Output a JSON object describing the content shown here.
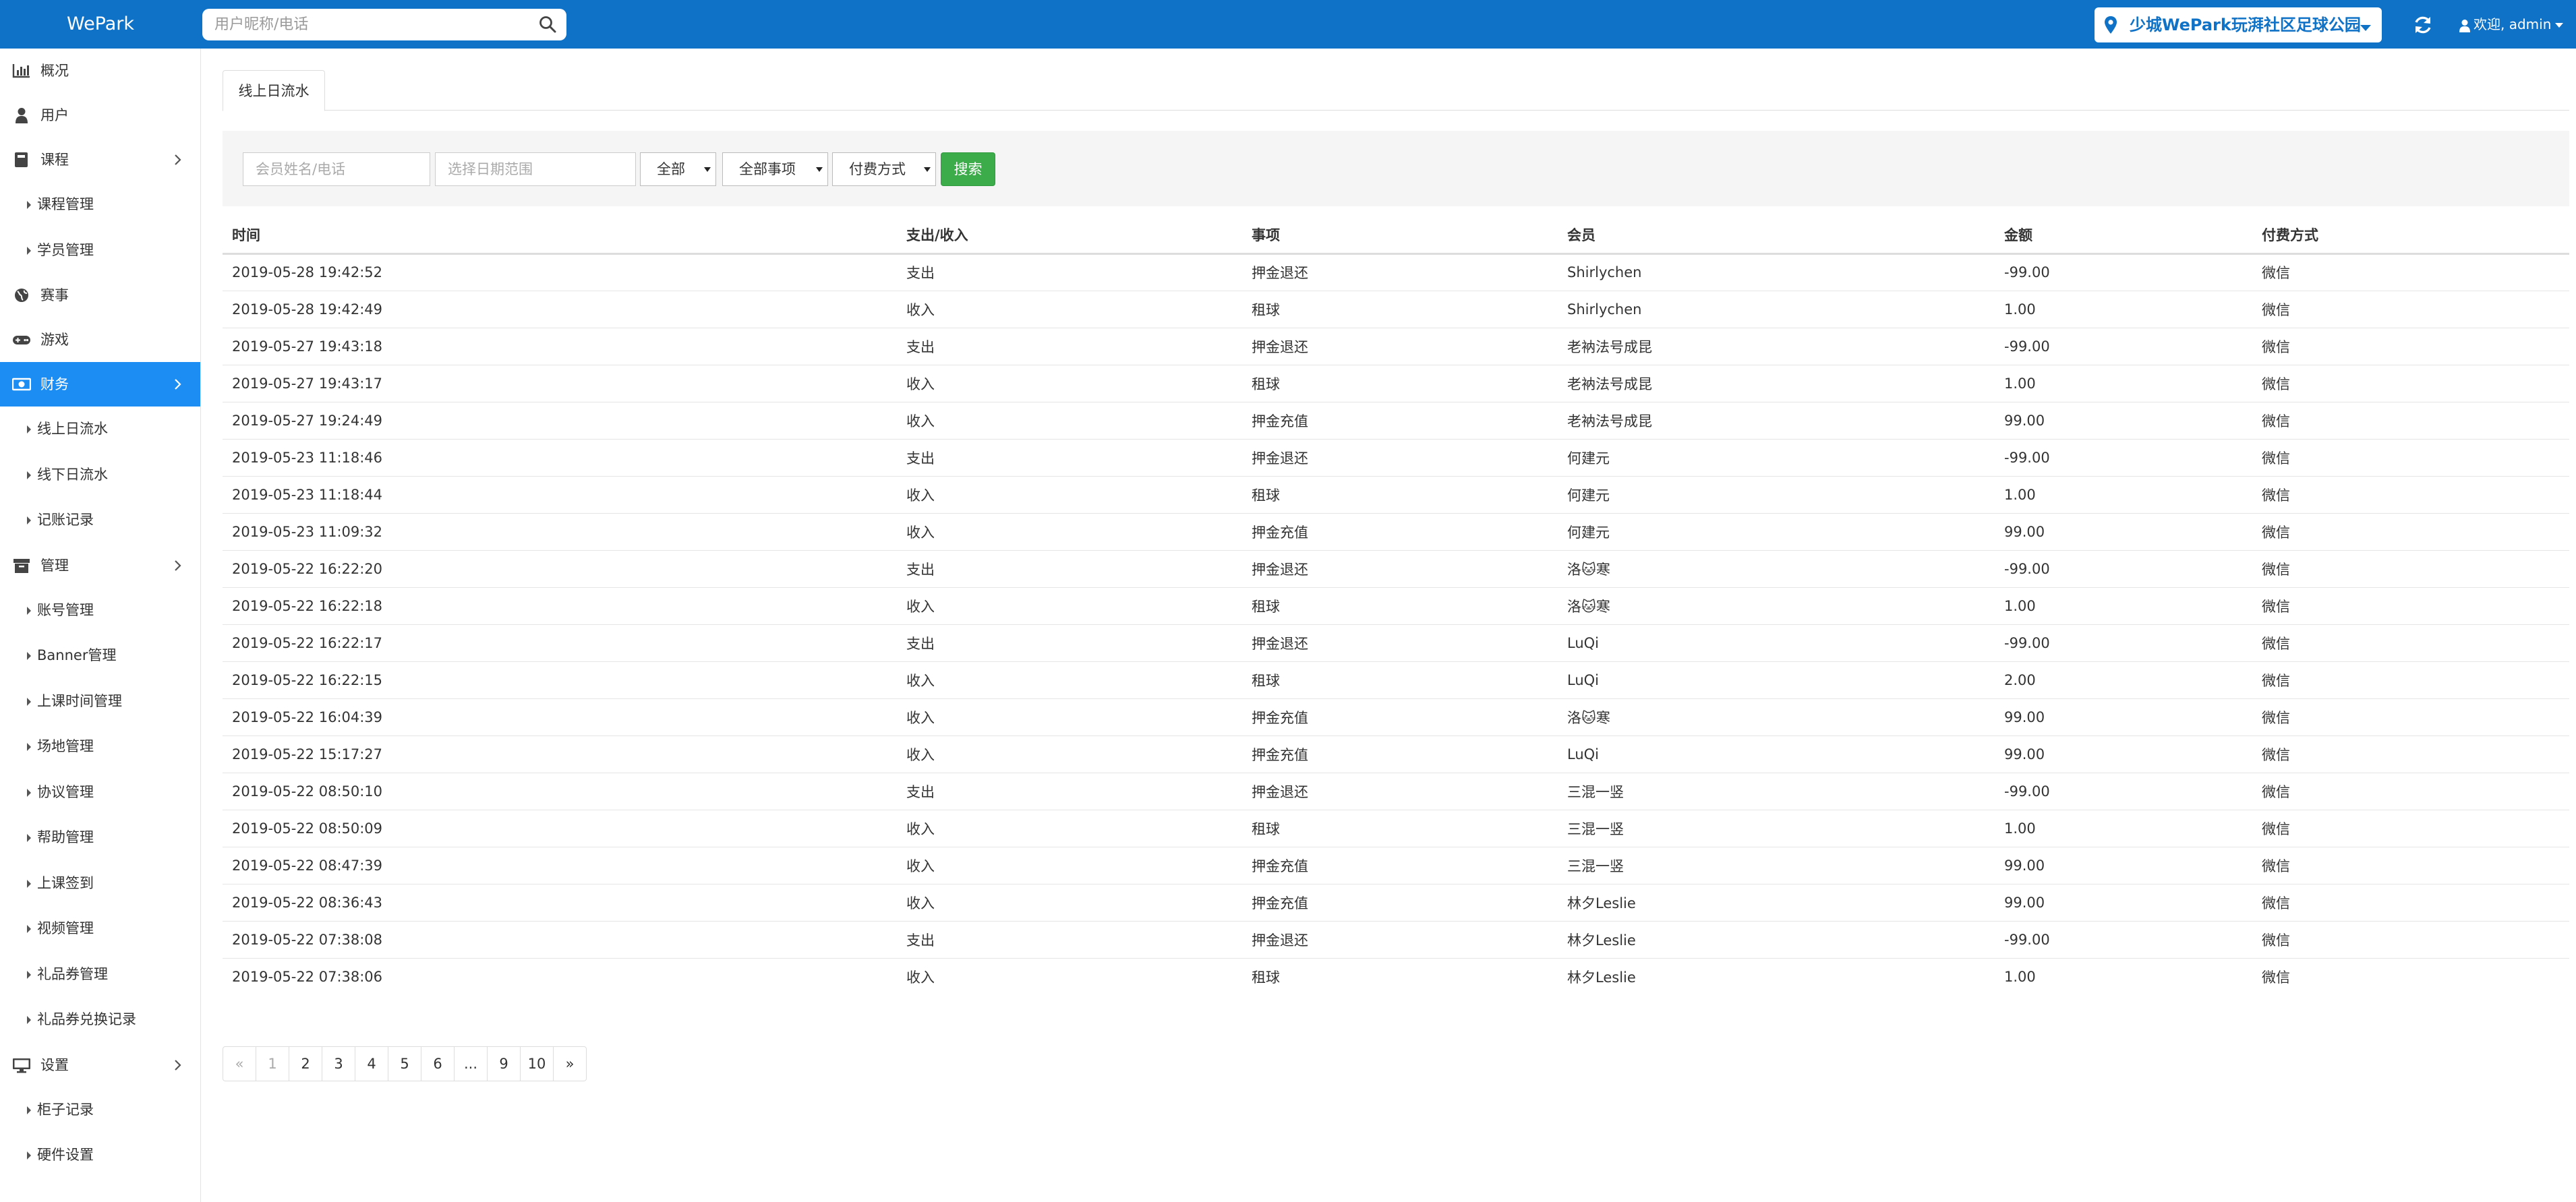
{
  "brand": "WePark",
  "search": {
    "placeholder": "用户昵称/电话"
  },
  "location": {
    "name": "少城WePark玩湃社区足球公园"
  },
  "user": {
    "greeting": "欢迎, admin"
  },
  "colors": {
    "topbar": "#1072c6",
    "active_nav": "#1c8ef3",
    "search_button": "#3cab4a"
  },
  "sidebar": {
    "items": [
      {
        "label": "概况",
        "icon": "bar-chart-icon"
      },
      {
        "label": "用户",
        "icon": "user-icon"
      },
      {
        "label": "课程",
        "icon": "book-icon",
        "expandable": true
      },
      {
        "label": "课程管理",
        "sub": true
      },
      {
        "label": "学员管理",
        "sub": true
      },
      {
        "label": "赛事",
        "icon": "globe-icon"
      },
      {
        "label": "游戏",
        "icon": "gamepad-icon"
      },
      {
        "label": "财务",
        "icon": "money-icon",
        "expandable": true,
        "active": true
      },
      {
        "label": "线上日流水",
        "sub": true
      },
      {
        "label": "线下日流水",
        "sub": true
      },
      {
        "label": "记账记录",
        "sub": true
      },
      {
        "label": "管理",
        "icon": "archive-icon",
        "expandable": true
      },
      {
        "label": "账号管理",
        "sub": true
      },
      {
        "label": "Banner管理",
        "sub": true
      },
      {
        "label": "上课时间管理",
        "sub": true
      },
      {
        "label": "场地管理",
        "sub": true
      },
      {
        "label": "协议管理",
        "sub": true
      },
      {
        "label": "帮助管理",
        "sub": true
      },
      {
        "label": "上课签到",
        "sub": true
      },
      {
        "label": "视频管理",
        "sub": true
      },
      {
        "label": "礼品券管理",
        "sub": true
      },
      {
        "label": "礼品券兑换记录",
        "sub": true
      },
      {
        "label": "设置",
        "icon": "desktop-icon",
        "expandable": true
      },
      {
        "label": "柜子记录",
        "sub": true
      },
      {
        "label": "硬件设置",
        "sub": true
      }
    ]
  },
  "tab": {
    "label": "线上日流水"
  },
  "filters": {
    "member_placeholder": "会员姓名/电话",
    "date_placeholder": "选择日期范围",
    "type_value": "全部",
    "item_value": "全部事项",
    "payment_value": "付费方式",
    "search_label": "搜索"
  },
  "table": {
    "headers": [
      "时间",
      "支出/收入",
      "事项",
      "会员",
      "金额",
      "付费方式"
    ],
    "rows": [
      [
        "2019-05-28 19:42:52",
        "支出",
        "押金退还",
        "Shirlychen",
        "-99.00",
        "微信"
      ],
      [
        "2019-05-28 19:42:49",
        "收入",
        "租球",
        "Shirlychen",
        "1.00",
        "微信"
      ],
      [
        "2019-05-27 19:43:18",
        "支出",
        "押金退还",
        "老衲法号成昆",
        "-99.00",
        "微信"
      ],
      [
        "2019-05-27 19:43:17",
        "收入",
        "租球",
        "老衲法号成昆",
        "1.00",
        "微信"
      ],
      [
        "2019-05-27 19:24:49",
        "收入",
        "押金充值",
        "老衲法号成昆",
        "99.00",
        "微信"
      ],
      [
        "2019-05-23 11:18:46",
        "支出",
        "押金退还",
        "何建元",
        "-99.00",
        "微信"
      ],
      [
        "2019-05-23 11:18:44",
        "收入",
        "租球",
        "何建元",
        "1.00",
        "微信"
      ],
      [
        "2019-05-23 11:09:32",
        "收入",
        "押金充值",
        "何建元",
        "99.00",
        "微信"
      ],
      [
        "2019-05-22 16:22:20",
        "支出",
        "押金退还",
        "洛🐱寒",
        "-99.00",
        "微信"
      ],
      [
        "2019-05-22 16:22:18",
        "收入",
        "租球",
        "洛🐱寒",
        "1.00",
        "微信"
      ],
      [
        "2019-05-22 16:22:17",
        "支出",
        "押金退还",
        "LuQi",
        "-99.00",
        "微信"
      ],
      [
        "2019-05-22 16:22:15",
        "收入",
        "租球",
        "LuQi",
        "2.00",
        "微信"
      ],
      [
        "2019-05-22 16:04:39",
        "收入",
        "押金充值",
        "洛🐱寒",
        "99.00",
        "微信"
      ],
      [
        "2019-05-22 15:17:27",
        "收入",
        "押金充值",
        "LuQi",
        "99.00",
        "微信"
      ],
      [
        "2019-05-22 08:50:10",
        "支出",
        "押金退还",
        "三混一竖",
        "-99.00",
        "微信"
      ],
      [
        "2019-05-22 08:50:09",
        "收入",
        "租球",
        "三混一竖",
        "1.00",
        "微信"
      ],
      [
        "2019-05-22 08:47:39",
        "收入",
        "押金充值",
        "三混一竖",
        "99.00",
        "微信"
      ],
      [
        "2019-05-22 08:36:43",
        "收入",
        "押金充值",
        "林夕Leslie",
        "99.00",
        "微信"
      ],
      [
        "2019-05-22 07:38:08",
        "支出",
        "押金退还",
        "林夕Leslie",
        "-99.00",
        "微信"
      ],
      [
        "2019-05-22 07:38:06",
        "收入",
        "租球",
        "林夕Leslie",
        "1.00",
        "微信"
      ]
    ]
  },
  "pagination": [
    "«",
    "1",
    "2",
    "3",
    "4",
    "5",
    "6",
    "...",
    "9",
    "10",
    "»"
  ]
}
